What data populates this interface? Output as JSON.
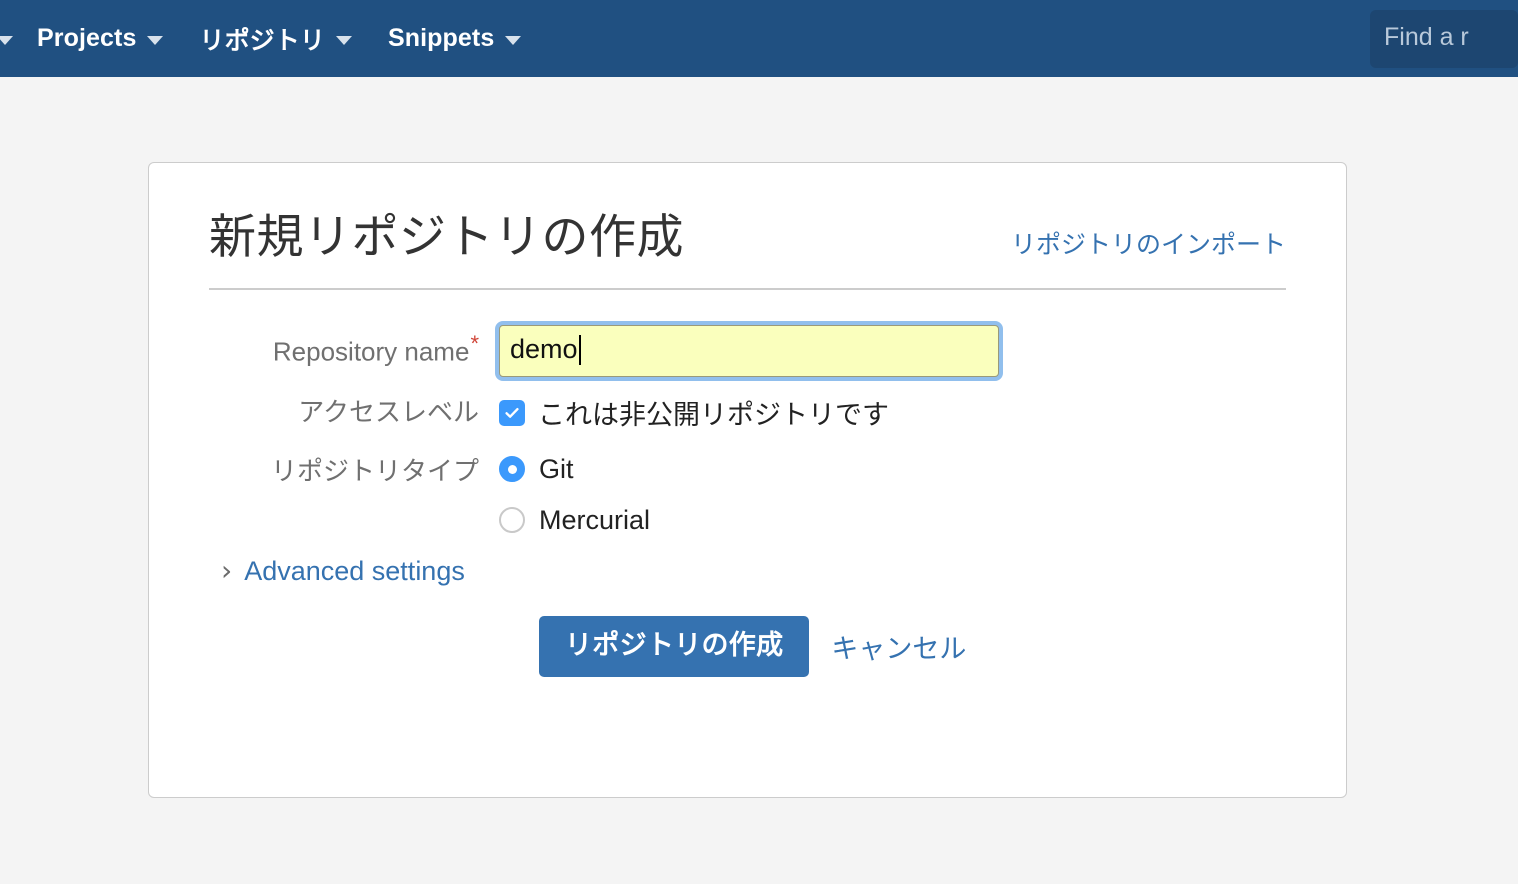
{
  "navbar": {
    "background_color": "#205081",
    "partial_item": {
      "label": "",
      "icon": "chevron-down-icon"
    },
    "items": [
      {
        "label": "Projects",
        "has_caret": true
      },
      {
        "label": "リポジトリ",
        "has_caret": true
      },
      {
        "label": "Snippets",
        "has_caret": true
      }
    ],
    "search": {
      "value": "",
      "placeholder": "Find a r"
    }
  },
  "card": {
    "title": "新規リポジトリの作成",
    "import_link": "リポジトリのインポート",
    "form": {
      "repository_name": {
        "label": "Repository name",
        "required_marker": "*",
        "value": "demo",
        "placeholder": ""
      },
      "access_level": {
        "label": "アクセスレベル",
        "checkbox_label": "これは非公開リポジトリです",
        "checked": "true"
      },
      "repository_type": {
        "label": "リポジトリタイプ",
        "options": [
          {
            "label": "Git",
            "selected": "true"
          },
          {
            "label": "Mercurial",
            "selected": "false"
          }
        ]
      },
      "advanced_settings": {
        "label": "Advanced settings",
        "icon": "chevron-right-icon",
        "expanded": "false"
      },
      "actions": {
        "submit_label": "リポジトリの作成",
        "cancel_label": "キャンセル"
      }
    }
  },
  "colors": {
    "navbar": "#205081",
    "page_background": "#f4f4f4",
    "card_background": "#ffffff",
    "link": "#3572b0",
    "primary_button": "#3572b0",
    "accent_control": "#3b99fc",
    "required_asterisk": "#d04437",
    "input_autofill": "#faffbd",
    "focus_ring": "#7eb4ea"
  }
}
